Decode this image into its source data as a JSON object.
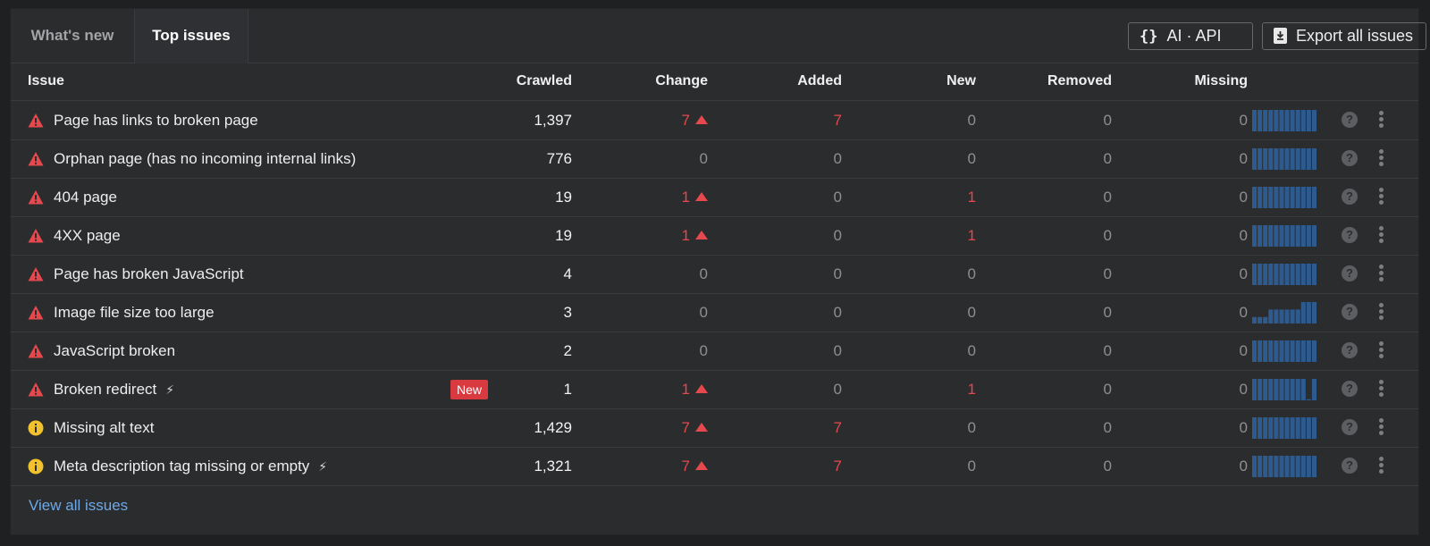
{
  "tabs": [
    {
      "label": "What's new"
    },
    {
      "label": "Top issues"
    }
  ],
  "toolbar": {
    "api_label": "AI · API",
    "export_label": "Export all issues"
  },
  "table": {
    "columns": [
      "Issue",
      "Crawled",
      "Change",
      "Added",
      "New",
      "Removed",
      "Missing"
    ],
    "rows": [
      {
        "severity": "error",
        "issue": "Page has links to broken page",
        "crawled": "1,397",
        "change": "7",
        "change_up": true,
        "added": "7",
        "new": "0",
        "removed": "0",
        "missing": "0",
        "trend": [
          1,
          1,
          1,
          1,
          1,
          1,
          1,
          1,
          1,
          1,
          1,
          1
        ],
        "badge": "",
        "bolt": false
      },
      {
        "severity": "error",
        "issue": "Orphan page (has no incoming internal links)",
        "crawled": "776",
        "change": "0",
        "change_up": false,
        "added": "0",
        "new": "0",
        "removed": "0",
        "missing": "0",
        "trend": [
          1,
          1,
          1,
          1,
          1,
          1,
          1,
          1,
          1,
          1,
          1,
          1
        ],
        "badge": "",
        "bolt": false
      },
      {
        "severity": "error",
        "issue": "404 page",
        "crawled": "19",
        "change": "1",
        "change_up": true,
        "added": "0",
        "new": "1",
        "removed": "0",
        "missing": "0",
        "trend": [
          1,
          1,
          1,
          1,
          1,
          1,
          1,
          1,
          1,
          1,
          1,
          1
        ],
        "badge": "",
        "bolt": false
      },
      {
        "severity": "error",
        "issue": "4XX page",
        "crawled": "19",
        "change": "1",
        "change_up": true,
        "added": "0",
        "new": "1",
        "removed": "0",
        "missing": "0",
        "trend": [
          1,
          1,
          1,
          1,
          1,
          1,
          1,
          1,
          1,
          1,
          1,
          1
        ],
        "badge": "",
        "bolt": false
      },
      {
        "severity": "error",
        "issue": "Page has broken JavaScript",
        "crawled": "4",
        "change": "0",
        "change_up": false,
        "added": "0",
        "new": "0",
        "removed": "0",
        "missing": "0",
        "trend": [
          1,
          1,
          1,
          1,
          1,
          1,
          1,
          1,
          1,
          1,
          1,
          1
        ],
        "badge": "",
        "bolt": false
      },
      {
        "severity": "error",
        "issue": "Image file size too large",
        "crawled": "3",
        "change": "0",
        "change_up": false,
        "added": "0",
        "new": "0",
        "removed": "0",
        "missing": "0",
        "trend": [
          0.3,
          0.3,
          0.3,
          0.65,
          0.65,
          0.65,
          0.65,
          0.65,
          0.65,
          1,
          1,
          1
        ],
        "badge": "",
        "bolt": false
      },
      {
        "severity": "error",
        "issue": "JavaScript broken",
        "crawled": "2",
        "change": "0",
        "change_up": false,
        "added": "0",
        "new": "0",
        "removed": "0",
        "missing": "0",
        "trend": [
          1,
          1,
          1,
          1,
          1,
          1,
          1,
          1,
          1,
          1,
          1,
          1
        ],
        "badge": "",
        "bolt": false
      },
      {
        "severity": "error",
        "issue": "Broken redirect",
        "crawled": "1",
        "change": "1",
        "change_up": true,
        "added": "0",
        "new": "1",
        "removed": "0",
        "missing": "0",
        "trend": [
          1,
          1,
          1,
          1,
          1,
          1,
          1,
          1,
          1,
          1,
          0.05,
          1
        ],
        "badge": "New",
        "bolt": true
      },
      {
        "severity": "warning",
        "issue": "Missing alt text",
        "crawled": "1,429",
        "change": "7",
        "change_up": true,
        "added": "7",
        "new": "0",
        "removed": "0",
        "missing": "0",
        "trend": [
          1,
          1,
          1,
          1,
          1,
          1,
          1,
          1,
          1,
          1,
          1,
          1
        ],
        "badge": "",
        "bolt": false
      },
      {
        "severity": "warning",
        "issue": "Meta description tag missing or empty",
        "crawled": "1,321",
        "change": "7",
        "change_up": true,
        "added": "7",
        "new": "0",
        "removed": "0",
        "missing": "0",
        "trend": [
          1,
          1,
          1,
          1,
          1,
          1,
          1,
          1,
          1,
          1,
          1,
          1
        ],
        "badge": "",
        "bolt": true
      }
    ]
  },
  "footer": {
    "link_label": "View all issues"
  },
  "colors": {
    "accent_red": "#e5484d",
    "warning_yellow": "#f2c12e",
    "spark_blue": "#2d5a8f",
    "link_blue": "#6ea8e6"
  },
  "icons": {
    "error": "warning-triangle-icon",
    "warning": "info-circle-icon"
  }
}
